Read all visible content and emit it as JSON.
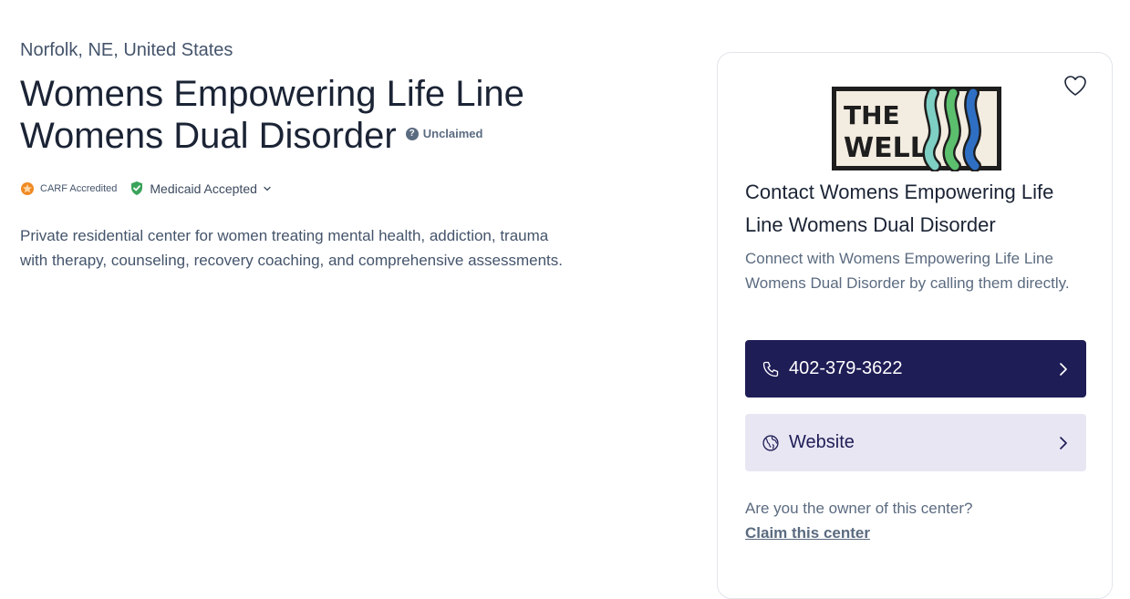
{
  "facility": {
    "location": "Norfolk, NE, United States",
    "name": "Womens Empowering Life Line Womens Dual Disorder",
    "claim_status": "Unclaimed",
    "description": "Private residential center for women treating mental health, addiction, trauma with therapy, counseling, recovery coaching, and comprehensive assessments."
  },
  "badges": {
    "carf": "CARF Accredited",
    "medicaid": "Medicaid Accepted"
  },
  "card": {
    "logo_line1": "THE",
    "logo_line2": "WELL",
    "contact_title": "Contact Womens Empowering Life Line Womens Dual Disorder",
    "contact_subtitle": "Connect with Womens Empowering Life Line Womens Dual Disorder by calling them directly.",
    "phone": "402-379-3622",
    "website_label": "Website",
    "owner_question": "Are you the owner of this center?",
    "claim_link": "Claim this center"
  },
  "colors": {
    "primary": "#1f1d56",
    "secondary_bg": "#e8e6f3",
    "carf_orange": "#f08a24",
    "medicaid_green": "#3aa35b"
  },
  "icons": {
    "favorite": "heart-icon",
    "phone": "phone-icon",
    "website": "globe-icon",
    "chevron": "chevron-right-icon",
    "dropdown": "chevron-down-icon",
    "help": "question-icon"
  }
}
